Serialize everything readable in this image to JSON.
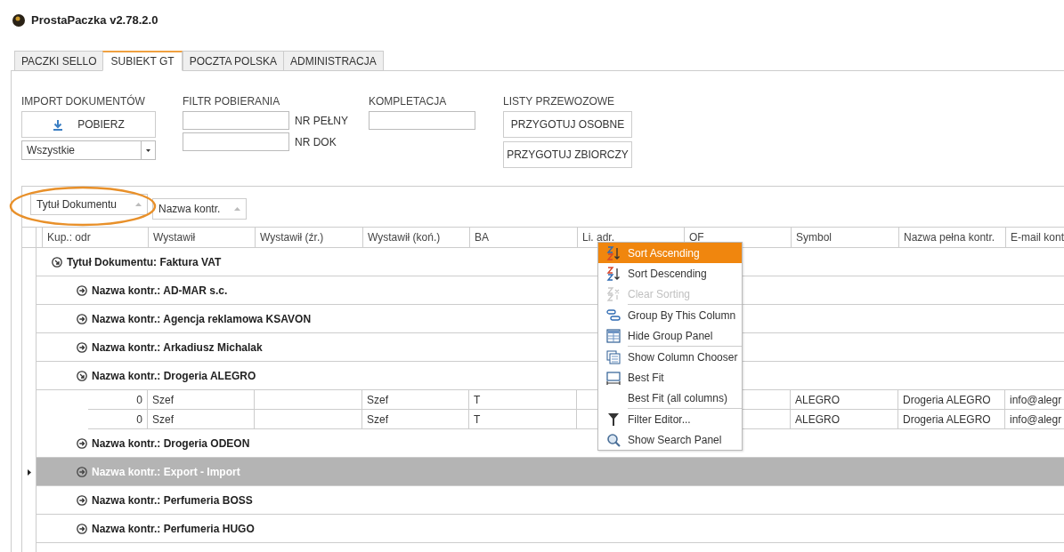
{
  "window": {
    "title": "ProstaPaczka v2.78.2.0"
  },
  "tabs": [
    {
      "label": "PACZKI SELLO",
      "selected": false
    },
    {
      "label": "SUBIEKT GT",
      "selected": true
    },
    {
      "label": "POCZTA POLSKA",
      "selected": false
    },
    {
      "label": "ADMINISTRACJA",
      "selected": false
    }
  ],
  "toolbar": {
    "import": {
      "label": "IMPORT DOKUMENTÓW",
      "button": "POBIERZ",
      "dropdown_value": "Wszystkie"
    },
    "filter": {
      "label": "FILTR POBIERANIA",
      "fields": [
        {
          "label": "NR PEŁNY"
        },
        {
          "label": "NR DOK"
        }
      ]
    },
    "completion": {
      "label": "KOMPLETACJA"
    },
    "waybills": {
      "label": "LISTY PRZEWOZOWE",
      "buttons": [
        "PRZYGOTUJ OSOBNE",
        "PRZYGOTUJ ZBIORCZY"
      ]
    }
  },
  "group_panel": {
    "chips": [
      "Tytuł Dokumentu",
      "Nazwa kontr."
    ]
  },
  "grid": {
    "columns": [
      "Kup.: odr",
      "Wystawił",
      "Wystawił (źr.)",
      "Wystawił (koń.)",
      "BA",
      "Li. adr.",
      "OF",
      "Symbol",
      "Nazwa pełna kontr.",
      "E-mail kont"
    ],
    "rows": [
      {
        "kind": "group",
        "text": "Tytuł Dokumentu: Faktura VAT",
        "expanded": true,
        "selected": false,
        "children": [
          {
            "kind": "group",
            "text": "Nazwa kontr.: AD-MAR s.c.",
            "expanded": false,
            "selected": false
          },
          {
            "kind": "group",
            "text": "Nazwa kontr.: Agencja reklamowa KSAVON",
            "expanded": false,
            "selected": false
          },
          {
            "kind": "group",
            "text": "Nazwa kontr.: Arkadiusz Michalak",
            "expanded": false,
            "selected": false
          },
          {
            "kind": "group",
            "text": "Nazwa kontr.: Drogeria ALEGRO",
            "expanded": true,
            "selected": false,
            "children": [
              {
                "kind": "data",
                "selected": false,
                "cells": [
                  "0",
                  "Szef",
                  null,
                  "Szef",
                  "T",
                  null,
                  null,
                  "ALEGRO",
                  "Drogeria ALEGRO",
                  "info@alegr"
                ]
              },
              {
                "kind": "data",
                "selected": false,
                "cells": [
                  "0",
                  "Szef",
                  null,
                  "Szef",
                  "T",
                  null,
                  null,
                  "ALEGRO",
                  "Drogeria ALEGRO",
                  "info@alegr"
                ]
              }
            ]
          },
          {
            "kind": "group",
            "text": "Nazwa kontr.: Drogeria ODEON",
            "expanded": false,
            "selected": false
          },
          {
            "kind": "group",
            "text": "Nazwa kontr.: Export - Import",
            "expanded": false,
            "selected": true
          },
          {
            "kind": "group",
            "text": "Nazwa kontr.: Perfumeria BOSS",
            "expanded": false,
            "selected": false
          },
          {
            "kind": "group",
            "text": "Nazwa kontr.: Perfumeria HUGO",
            "expanded": false,
            "selected": false
          }
        ]
      }
    ]
  },
  "context_menu": {
    "items": [
      {
        "label": "Sort Ascending",
        "selected": true,
        "disabled": false,
        "separator_before": false
      },
      {
        "label": "Sort Descending",
        "selected": false,
        "disabled": false,
        "separator_before": false
      },
      {
        "label": "Clear Sorting",
        "selected": false,
        "disabled": true,
        "separator_before": false
      },
      {
        "label": "Group By This Column",
        "selected": false,
        "disabled": false,
        "separator_before": true
      },
      {
        "label": "Hide Group Panel",
        "selected": false,
        "disabled": false,
        "separator_before": false
      },
      {
        "label": "Show Column Chooser",
        "selected": false,
        "disabled": false,
        "separator_before": true
      },
      {
        "label": "Best Fit",
        "selected": false,
        "disabled": false,
        "separator_before": false
      },
      {
        "label": "Best Fit (all columns)",
        "selected": false,
        "disabled": false,
        "separator_before": false
      },
      {
        "label": "Filter Editor...",
        "selected": false,
        "disabled": false,
        "separator_before": true
      },
      {
        "label": "Show Search Panel",
        "selected": false,
        "disabled": false,
        "separator_before": false
      }
    ]
  }
}
